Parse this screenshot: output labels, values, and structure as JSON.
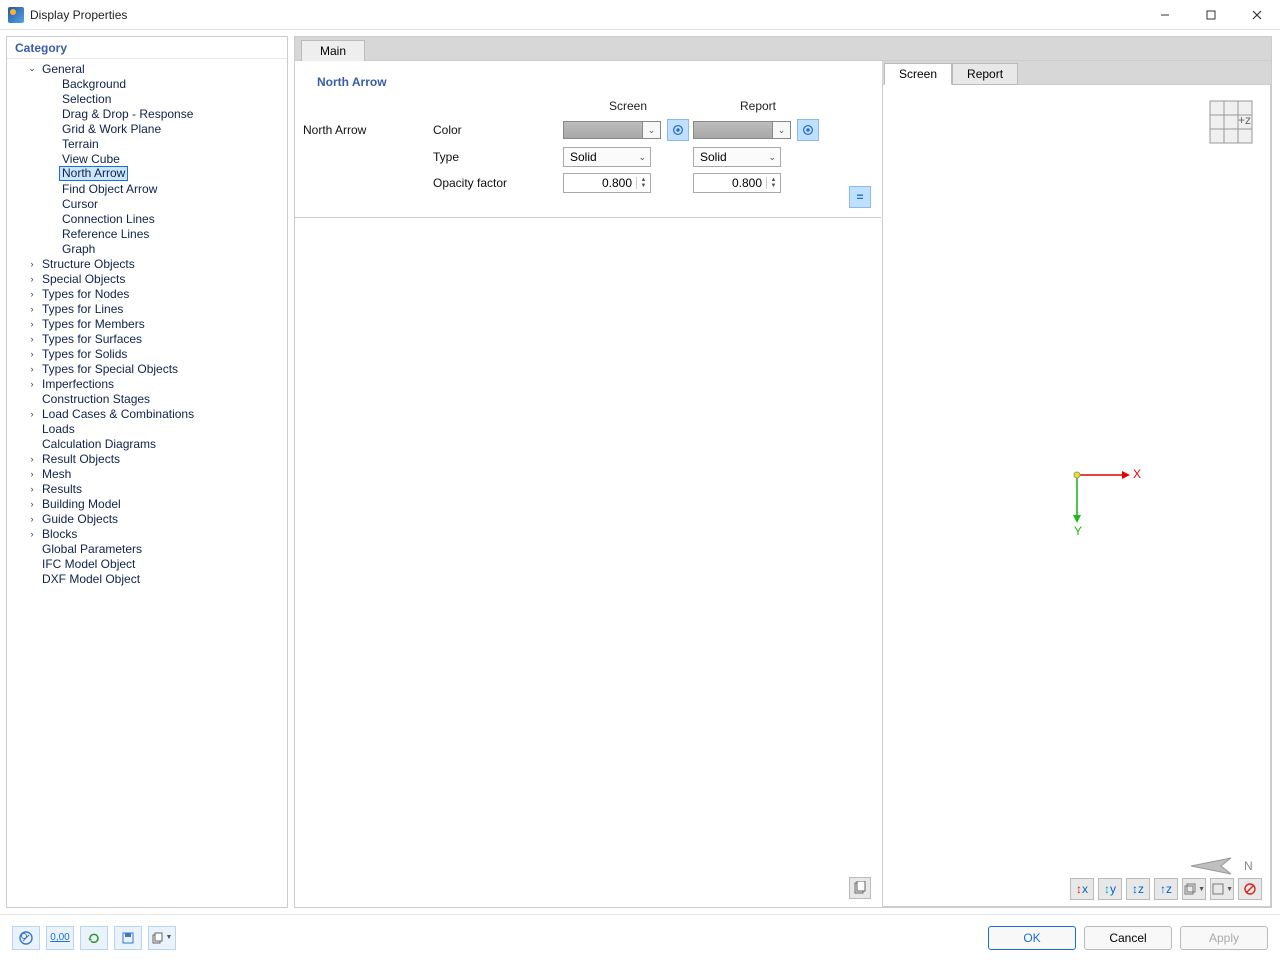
{
  "window": {
    "title": "Display Properties"
  },
  "sidebar": {
    "header": "Category",
    "selected": "North Arrow",
    "items": [
      {
        "label": "General",
        "level": 1,
        "chev": "down"
      },
      {
        "label": "Background",
        "level": 2
      },
      {
        "label": "Selection",
        "level": 2
      },
      {
        "label": "Drag & Drop - Response",
        "level": 2
      },
      {
        "label": "Grid & Work Plane",
        "level": 2
      },
      {
        "label": "Terrain",
        "level": 2
      },
      {
        "label": "View Cube",
        "level": 2
      },
      {
        "label": "North Arrow",
        "level": 2,
        "selected": true
      },
      {
        "label": "Find Object Arrow",
        "level": 2
      },
      {
        "label": "Cursor",
        "level": 2
      },
      {
        "label": "Connection Lines",
        "level": 2
      },
      {
        "label": "Reference Lines",
        "level": 2
      },
      {
        "label": "Graph",
        "level": 2
      },
      {
        "label": "Structure Objects",
        "level": 1,
        "chev": "right"
      },
      {
        "label": "Special Objects",
        "level": 1,
        "chev": "right"
      },
      {
        "label": "Types for Nodes",
        "level": 1,
        "chev": "right"
      },
      {
        "label": "Types for Lines",
        "level": 1,
        "chev": "right"
      },
      {
        "label": "Types for Members",
        "level": 1,
        "chev": "right"
      },
      {
        "label": "Types for Surfaces",
        "level": 1,
        "chev": "right"
      },
      {
        "label": "Types for Solids",
        "level": 1,
        "chev": "right"
      },
      {
        "label": "Types for Special Objects",
        "level": 1,
        "chev": "right"
      },
      {
        "label": "Imperfections",
        "level": 1,
        "chev": "right"
      },
      {
        "label": "Construction Stages",
        "level": 1
      },
      {
        "label": "Load Cases & Combinations",
        "level": 1,
        "chev": "right"
      },
      {
        "label": "Loads",
        "level": 1
      },
      {
        "label": "Calculation Diagrams",
        "level": 1
      },
      {
        "label": "Result Objects",
        "level": 1,
        "chev": "right"
      },
      {
        "label": "Mesh",
        "level": 1,
        "chev": "right"
      },
      {
        "label": "Results",
        "level": 1,
        "chev": "right"
      },
      {
        "label": "Building Model",
        "level": 1,
        "chev": "right"
      },
      {
        "label": "Guide Objects",
        "level": 1,
        "chev": "right"
      },
      {
        "label": "Blocks",
        "level": 1,
        "chev": "right"
      },
      {
        "label": "Global Parameters",
        "level": 1
      },
      {
        "label": "IFC Model Object",
        "level": 1
      },
      {
        "label": "DXF Model Object",
        "level": 1
      }
    ]
  },
  "main": {
    "tab": "Main",
    "section_title": "North Arrow",
    "row_label": "North Arrow",
    "cols": {
      "screen": "Screen",
      "report": "Report"
    },
    "rows": {
      "color": {
        "label": "Color",
        "screen": "#a8a8a8",
        "report": "#a8a8a8"
      },
      "type": {
        "label": "Type",
        "screen": "Solid",
        "report": "Solid"
      },
      "opacity": {
        "label": "Opacity factor",
        "screen": "0.800",
        "report": "0.800"
      }
    },
    "sync": "="
  },
  "preview": {
    "tabs": [
      "Screen",
      "Report"
    ],
    "active_tab": "Screen",
    "cube_label": "+z",
    "axes": {
      "x": "X",
      "y": "Y"
    },
    "northarrow_label": "N",
    "toolbar": [
      "-X",
      "-Y",
      "-Z",
      "+Z",
      "iso",
      "box",
      "reset"
    ]
  },
  "buttons": {
    "ok": "OK",
    "cancel": "Cancel",
    "apply": "Apply"
  }
}
